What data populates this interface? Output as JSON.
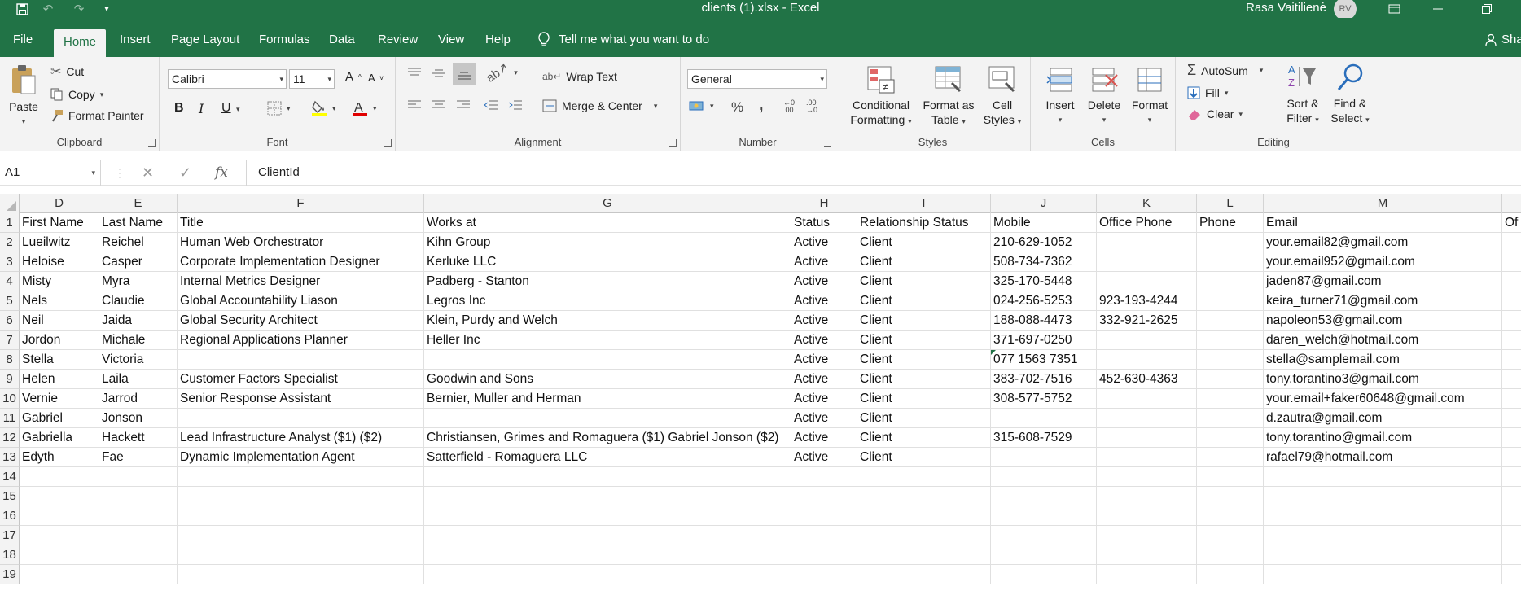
{
  "window": {
    "title": "clients (1).xlsx  -  Excel",
    "user_name": "Rasa Vaitilienė",
    "user_initials": "RV"
  },
  "tabs": [
    "File",
    "Home",
    "Insert",
    "Page Layout",
    "Formulas",
    "Data",
    "Review",
    "View",
    "Help"
  ],
  "tell_me": "Tell me what you want to do",
  "share": "Sha",
  "ribbon": {
    "clipboard": {
      "paste": "Paste",
      "cut": "Cut",
      "copy": "Copy",
      "format_painter": "Format Painter",
      "label": "Clipboard"
    },
    "font": {
      "font_name": "Calibri",
      "font_size": "11",
      "bold": "B",
      "italic": "I",
      "underline": "U",
      "label": "Font"
    },
    "alignment": {
      "wrap_text": "Wrap Text",
      "merge_center": "Merge & Center",
      "label": "Alignment"
    },
    "number": {
      "format": "General",
      "percent": "%",
      "comma": ",",
      "label": "Number"
    },
    "styles": {
      "conditional": "Conditional",
      "formatting": "Formatting",
      "format_as": "Format as",
      "table": "Table",
      "cell": "Cell",
      "cell_styles": "Styles",
      "label": "Styles"
    },
    "cells": {
      "insert": "Insert",
      "delete": "Delete",
      "format": "Format",
      "label": "Cells"
    },
    "editing": {
      "autosum": "AutoSum",
      "fill": "Fill",
      "clear": "Clear",
      "sort": "Sort &",
      "filter": "Filter",
      "find": "Find &",
      "select": "Select",
      "label": "Editing"
    }
  },
  "formula_bar": {
    "name_box": "A1",
    "fx": "fx",
    "content": "ClientId"
  },
  "columns": [
    {
      "letter": "D"
    },
    {
      "letter": "E"
    },
    {
      "letter": "F"
    },
    {
      "letter": "G"
    },
    {
      "letter": "H"
    },
    {
      "letter": "I"
    },
    {
      "letter": "J"
    },
    {
      "letter": "K"
    },
    {
      "letter": "L"
    },
    {
      "letter": "M"
    },
    {
      "letter": ""
    }
  ],
  "rows": [
    {
      "n": "1",
      "cells": [
        "First Name",
        "Last Name",
        "Title",
        "Works at",
        "Status",
        "Relationship Status",
        "Mobile",
        "Office Phone",
        "Phone",
        "Email",
        "Of"
      ]
    },
    {
      "n": "2",
      "cells": [
        "Lueilwitz",
        "Reichel",
        "Human Web Orchestrator",
        "Kihn Group",
        "Active",
        "Client",
        "210-629-1052",
        "",
        "",
        "your.email82@gmail.com",
        ""
      ]
    },
    {
      "n": "3",
      "cells": [
        "Heloise",
        "Casper",
        "Corporate Implementation Designer",
        "Kerluke LLC",
        "Active",
        "Client",
        "508-734-7362",
        "",
        "",
        "your.email952@gmail.com",
        ""
      ]
    },
    {
      "n": "4",
      "cells": [
        "Misty",
        "Myra",
        "Internal Metrics Designer",
        "Padberg - Stanton",
        "Active",
        "Client",
        "325-170-5448",
        "",
        "",
        "jaden87@gmail.com",
        ""
      ]
    },
    {
      "n": "5",
      "cells": [
        "Nels",
        "Claudie",
        "Global Accountability Liason",
        "Legros Inc",
        "Active",
        "Client",
        "024-256-5253",
        "923-193-4244",
        "",
        "keira_turner71@gmail.com",
        ""
      ]
    },
    {
      "n": "6",
      "cells": [
        "Neil",
        "Jaida",
        "Global Security Architect",
        "Klein, Purdy and Welch",
        "Active",
        "Client",
        "188-088-4473",
        "332-921-2625",
        "",
        "napoleon53@gmail.com",
        ""
      ]
    },
    {
      "n": "7",
      "cells": [
        "Jordon",
        "Michale",
        "Regional Applications Planner",
        "Heller Inc",
        "Active",
        "Client",
        "371-697-0250",
        "",
        "",
        "daren_welch@hotmail.com",
        ""
      ]
    },
    {
      "n": "8",
      "cells": [
        "Stella",
        "Victoria",
        "",
        "",
        "Active",
        "Client",
        "077 1563 7351",
        "",
        "",
        "stella@samplemail.com",
        ""
      ]
    },
    {
      "n": "9",
      "cells": [
        "Helen",
        "Laila",
        "Customer Factors Specialist",
        "Goodwin and Sons",
        "Active",
        "Client",
        "383-702-7516",
        "452-630-4363",
        "",
        "tony.torantino3@gmail.com",
        ""
      ]
    },
    {
      "n": "10",
      "cells": [
        "Vernie",
        "Jarrod",
        "Senior Response Assistant",
        "Bernier, Muller and Herman",
        "Active",
        "Client",
        "308-577-5752",
        "",
        "",
        "your.email+faker60648@gmail.com",
        ""
      ]
    },
    {
      "n": "11",
      "cells": [
        "Gabriel",
        "Jonson",
        "",
        "",
        "Active",
        "Client",
        "",
        "",
        "",
        "d.zautra@gmail.com",
        ""
      ]
    },
    {
      "n": "12",
      "cells": [
        "Gabriella",
        "Hackett",
        "Lead Infrastructure Analyst ($1)  ($2)",
        "Christiansen, Grimes and Romaguera ($1) Gabriel Jonson ($2)",
        "Active",
        "Client",
        "315-608-7529",
        "",
        "",
        "tony.torantino@gmail.com",
        ""
      ]
    },
    {
      "n": "13",
      "cells": [
        "Edyth",
        "Fae",
        "Dynamic Implementation Agent",
        "Satterfield - Romaguera LLC",
        "Active",
        "Client",
        "",
        "",
        "",
        "rafael79@hotmail.com",
        ""
      ]
    },
    {
      "n": "14",
      "cells": [
        "",
        "",
        "",
        "",
        "",
        "",
        "",
        "",
        "",
        "",
        ""
      ]
    },
    {
      "n": "15",
      "cells": [
        "",
        "",
        "",
        "",
        "",
        "",
        "",
        "",
        "",
        "",
        ""
      ]
    },
    {
      "n": "16",
      "cells": [
        "",
        "",
        "",
        "",
        "",
        "",
        "",
        "",
        "",
        "",
        ""
      ]
    },
    {
      "n": "17",
      "cells": [
        "",
        "",
        "",
        "",
        "",
        "",
        "",
        "",
        "",
        "",
        ""
      ]
    },
    {
      "n": "18",
      "cells": [
        "",
        "",
        "",
        "",
        "",
        "",
        "",
        "",
        "",
        "",
        ""
      ]
    },
    {
      "n": "19",
      "cells": [
        "",
        "",
        "",
        "",
        "",
        "",
        "",
        "",
        "",
        "",
        ""
      ]
    }
  ]
}
